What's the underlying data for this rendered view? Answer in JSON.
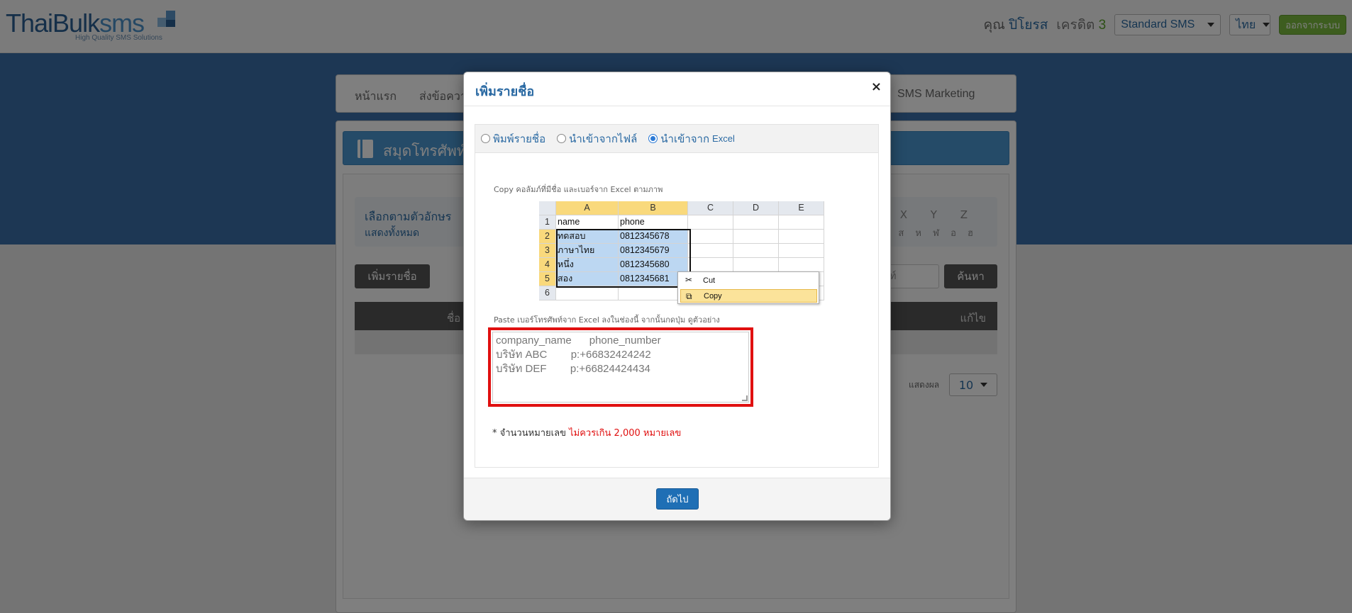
{
  "header": {
    "logo_main": "ThaiBulk",
    "logo_accent": "sms",
    "logo_tagline": "High Quality SMS Solutions",
    "greeting": "คุณ",
    "username": "ปิโยรส",
    "credit_label": "เครดิต",
    "credit_value": "3",
    "sms_type": "Standard SMS",
    "language": "ไทย",
    "logout_label": "ออกจากระบบ"
  },
  "nav": {
    "home": "หน้าแรก",
    "send": "ส่งข้อควา",
    "marketing": "SMS Marketing"
  },
  "phonebook": {
    "title": "สมุดโทรศัพท์",
    "filter_title": "เลือกตามตัวอักษร",
    "filter_show_all": "แสดงทั้งหมด",
    "letters_en": "W X Y Z",
    "letters_th": "ว ศ ษ ส ห ฬ อ ฮ",
    "add_button": "เพิ่มรายชื่อ",
    "search_placeholder": "พท์",
    "search_button": "ค้นหา",
    "col_name": "ชื่อ",
    "col_edit": "แก้ไข",
    "show_label": "แสดงผล",
    "page_size": "10"
  },
  "modal": {
    "title": "เพิ่มรายชื่อ",
    "close": "×",
    "radio": {
      "type": "พิมพ์รายชื่อ",
      "file": "นำเข้าจากไฟล์",
      "excel_prefix": "นำเข้าจาก",
      "excel_word": "Excel"
    },
    "hint_copy": "Copy คอลัมภ์ที่มีชื่อ และเบอร์จาก Excel ตามภาพ",
    "hint_paste": "Paste เบอร์โทรศัพท์จาก Excel ลงในช่องนี้ จากนั้นกดปุ่ม ดูตัวอย่าง",
    "excel": {
      "columns": [
        "A",
        "B",
        "C",
        "D",
        "E"
      ],
      "rows": [
        {
          "num": "1",
          "a": "name",
          "b": "phone"
        },
        {
          "num": "2",
          "a": "ทดสอบ",
          "b": "0812345678"
        },
        {
          "num": "3",
          "a": "ภาษาไทย",
          "b": "0812345679"
        },
        {
          "num": "4",
          "a": "หนึ่ง",
          "b": "0812345680"
        },
        {
          "num": "5",
          "a": "สอง",
          "b": "0812345681"
        },
        {
          "num": "6",
          "a": "",
          "b": ""
        }
      ],
      "menu_cut": "Cut",
      "menu_copy": "Copy"
    },
    "paste_lines": [
      "company_name      phone_number",
      "บริษัท ABC        p:+66832424242",
      "บริษัท DEF        p:+66824424434"
    ],
    "note_prefix": "* จำนวนหมายเลข",
    "note_warning": "ไม่ควรเกิน 2,000 หมายเลข",
    "next_button": "ถัดไป"
  }
}
